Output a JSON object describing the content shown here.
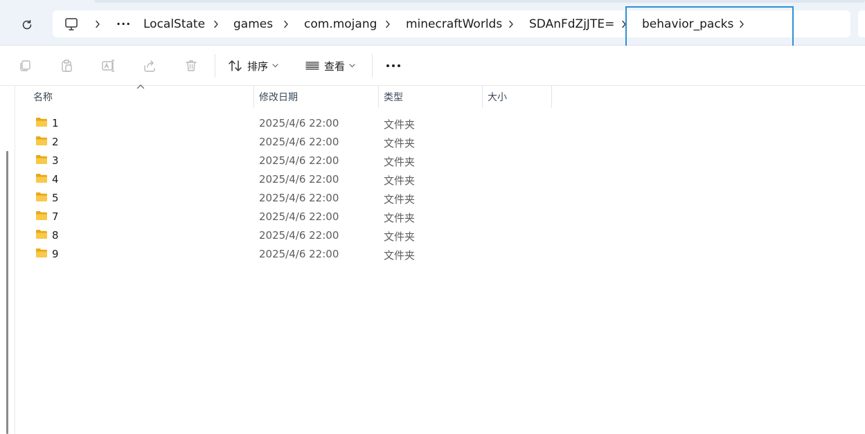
{
  "address_bar": {
    "crumbs": [
      "LocalState",
      "games",
      "com.mojang",
      "minecraftWorlds",
      "SDAnFdZjJTE=",
      "behavior_packs"
    ],
    "overflow_label": "···"
  },
  "command_bar": {
    "sort_label": "排序",
    "view_label": "查看",
    "more_label": "···"
  },
  "columns": {
    "name": "名称",
    "modified": "修改日期",
    "type": "类型",
    "size": "大小"
  },
  "rows": [
    {
      "name": "1",
      "modified": "2025/4/6 22:00",
      "type": "文件夹",
      "size": ""
    },
    {
      "name": "2",
      "modified": "2025/4/6 22:00",
      "type": "文件夹",
      "size": ""
    },
    {
      "name": "3",
      "modified": "2025/4/6 22:00",
      "type": "文件夹",
      "size": ""
    },
    {
      "name": "4",
      "modified": "2025/4/6 22:00",
      "type": "文件夹",
      "size": ""
    },
    {
      "name": "5",
      "modified": "2025/4/6 22:00",
      "type": "文件夹",
      "size": ""
    },
    {
      "name": "7",
      "modified": "2025/4/6 22:00",
      "type": "文件夹",
      "size": ""
    },
    {
      "name": "8",
      "modified": "2025/4/6 22:00",
      "type": "文件夹",
      "size": ""
    },
    {
      "name": "9",
      "modified": "2025/4/6 22:00",
      "type": "文件夹",
      "size": ""
    }
  ],
  "colors": {
    "address_region_bg": "#eef3f9",
    "highlight_border": "#2f8fd6",
    "folder_yellow": "#f5c33b"
  }
}
